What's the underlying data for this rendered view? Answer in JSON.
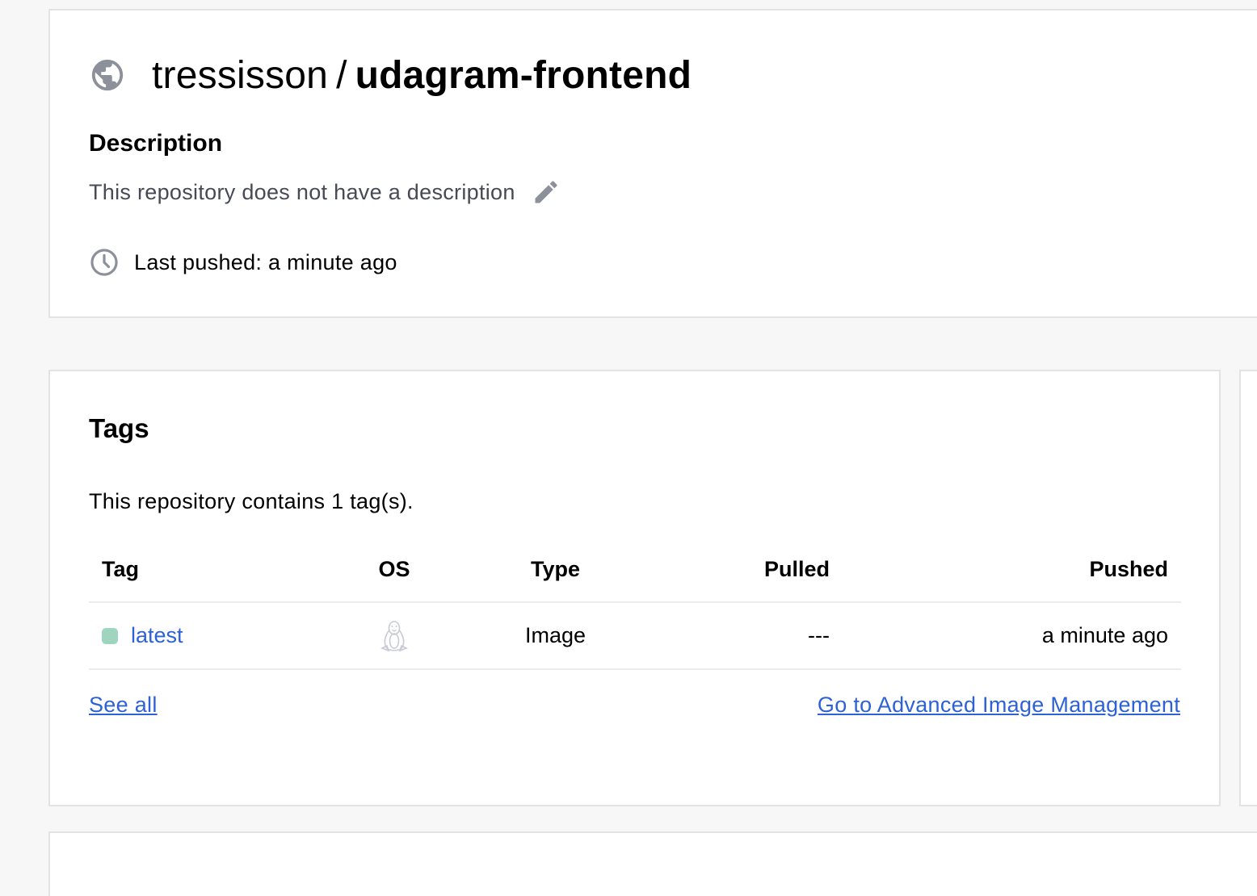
{
  "repository": {
    "namespace": "tressisson",
    "separator": "/",
    "name": "udagram-frontend",
    "visibility_icon": "globe-icon"
  },
  "description": {
    "heading": "Description",
    "text": "This repository does not have a description",
    "edit_icon": "pencil-icon"
  },
  "last_pushed": {
    "icon": "clock-icon",
    "text": "Last pushed: a minute ago"
  },
  "tags": {
    "heading": "Tags",
    "summary": "This repository contains 1 tag(s).",
    "columns": {
      "tag": "Tag",
      "os": "OS",
      "type": "Type",
      "pulled": "Pulled",
      "pushed": "Pushed"
    },
    "rows": [
      {
        "tag": "latest",
        "os_icon": "linux-tux-icon",
        "type": "Image",
        "pulled": "---",
        "pushed": "a minute ago",
        "status_color": "#9fd4bf"
      }
    ],
    "see_all": "See all",
    "advanced_link": "Go to Advanced Image Management"
  },
  "colors": {
    "link": "#2d62d6",
    "icon_gray": "#8c909a",
    "background": "#f7f7f7",
    "card_border": "#e3e3e3"
  }
}
